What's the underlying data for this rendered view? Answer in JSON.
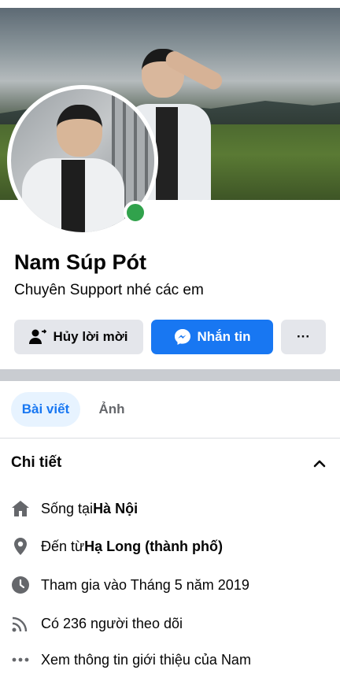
{
  "profile": {
    "name": "Nam Súp Pót",
    "bio": "Chuyên Support nhé các em",
    "online": true
  },
  "actions": {
    "cancel_request_label": "Hủy lời mời",
    "message_label": "Nhắn tin",
    "more_label": "···"
  },
  "tabs": [
    {
      "label": "Bài viết",
      "active": true
    },
    {
      "label": "Ảnh",
      "active": false
    }
  ],
  "details": {
    "title": "Chi tiết",
    "lives_prefix": "Sống tại ",
    "lives_value": "Hà Nội",
    "from_prefix": "Đến từ ",
    "from_value": "Hạ Long (thành phố)",
    "joined": "Tham gia vào Tháng 5 năm 2019",
    "followers": "Có 236 người theo dõi",
    "see_more": "Xem thông tin giới thiệu của Nam"
  },
  "colors": {
    "accent": "#1877f2",
    "online": "#31a24c",
    "icon_gray": "#65676b"
  }
}
